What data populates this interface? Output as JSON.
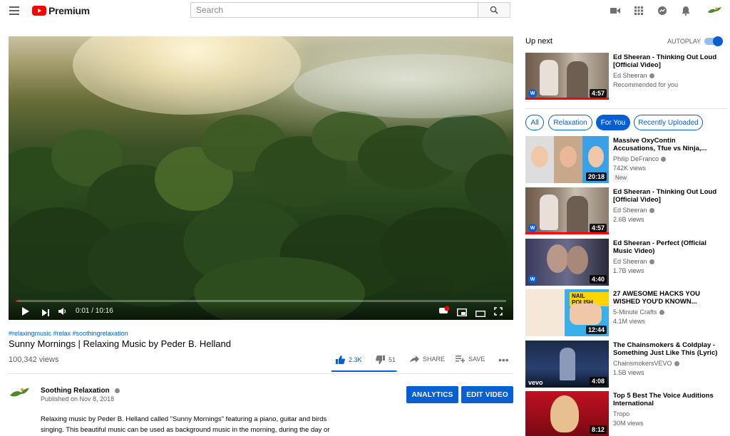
{
  "header": {
    "brand": "Premium",
    "search_placeholder": "Search"
  },
  "player": {
    "time": "0:01 / 10:16",
    "progress": 0.0016
  },
  "video": {
    "tags": "#relaxingmusic #relax #soothingrelaxation",
    "title": "Sunny Mornings | Relaxing Music by Peder B. Helland",
    "views": "100,342 views",
    "likes": "2.3K",
    "dislikes": "51",
    "like_ratio": 0.978,
    "share_label": "SHARE",
    "save_label": "SAVE"
  },
  "channel": {
    "name": "Soothing Relaxation",
    "published": "Published on Nov 8, 2018",
    "analytics_label": "ANALYTICS",
    "edit_label": "EDIT VIDEO",
    "description_line1": "Relaxing music by Peder B. Helland called \"Sunny Mornings\" featuring a piano, guitar and birds",
    "description_line2": "singing. This beautiful music can be used as background music in the morning, during the day or"
  },
  "sidebar": {
    "up_next_label": "Up next",
    "autoplay_label": "AUTOPLAY",
    "autoplay_on": true,
    "up_next": {
      "title_line1": "Ed Sheeran - Thinking Out Loud",
      "title_line2": "[Official Video]",
      "channel": "Ed Sheeran",
      "meta": "Recommended for you",
      "duration": "4:57"
    },
    "chips": [
      "All",
      "Relaxation",
      "For You",
      "Recently Uploaded"
    ],
    "selected_chip": "For You",
    "items": [
      {
        "title_line1": "Massive OxyContin",
        "title_line2": "Accusations, Tfue vs Ninja,...",
        "channel": "Philip DeFranco",
        "views": "742K views",
        "badge": "New",
        "duration": "20:18"
      },
      {
        "title_line1": "Ed Sheeran - Thinking Out Loud",
        "title_line2": "[Official Video]",
        "channel": "Ed Sheeran",
        "views": "2.6B views",
        "duration": "4:57"
      },
      {
        "title_line1": "Ed Sheeran - Perfect (Official",
        "title_line2": "Music Video)",
        "channel": "Ed Sheeran",
        "views": "1.7B views",
        "duration": "4:40"
      },
      {
        "title_line1": "27 AWESOME HACKS YOU",
        "title_line2": "WISHED YOU'D KNOWN...",
        "channel": "5-Minute Crafts",
        "views": "4.1M views",
        "duration": "12:44",
        "thumb_text": "NAIL POLISH"
      },
      {
        "title_line1": "The Chainsmokers & Coldplay -",
        "title_line2": "Something Just Like This (Lyric)",
        "channel": "ChainsmokersVEVO",
        "views": "1.5B views",
        "duration": "4:08",
        "thumb_text": "vevo"
      },
      {
        "title_line1": "Top 5 Best The Voice Auditions",
        "title_line2": "International",
        "channel": "Tropo",
        "views": "30M views",
        "duration": "8:12"
      }
    ]
  },
  "colors": {
    "accent": "#065fd4",
    "brand_red": "#ff0000"
  }
}
